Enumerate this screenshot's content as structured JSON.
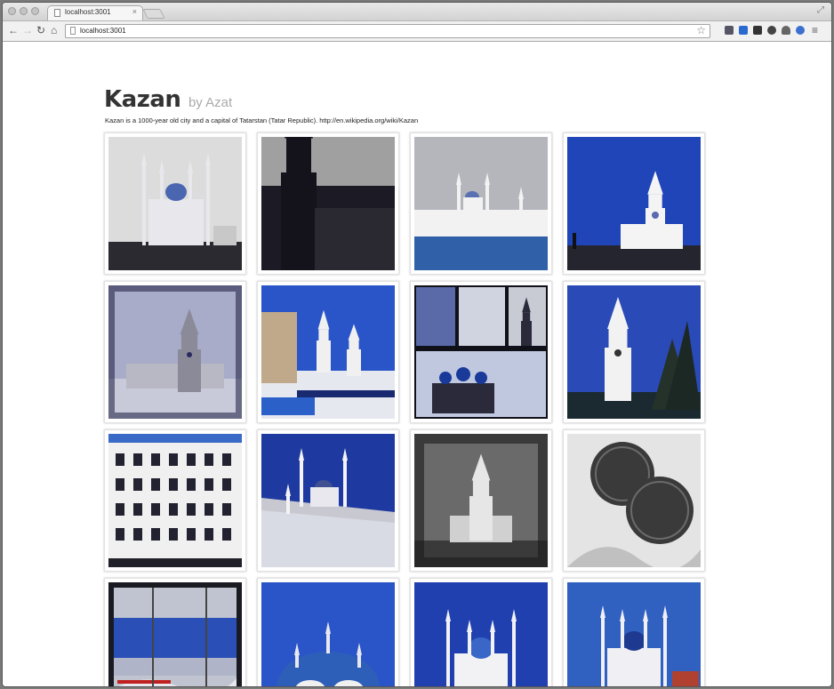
{
  "browser": {
    "tab_title": "localhost:3001",
    "tab_close": "×",
    "url": "localhost:3001"
  },
  "page": {
    "title": "Kazan",
    "subtitle": "by Azat",
    "description": "Kazan is a 1000-year old city and a capital of Tatarstan (Tatar Republic). http://en.wikipedia.org/wiki/Kazan"
  },
  "photos": [
    {
      "name": "photo-qolsharif-mosque",
      "scene": "mosque",
      "palette": {
        "sky": "#dcdcdc",
        "ground": "#2a2a30",
        "main": "#e8e8ec",
        "accent": "#4a66b0"
      }
    },
    {
      "name": "photo-dark-tower-silhouette",
      "scene": "silhouette",
      "palette": {
        "sky": "#b8b8b8",
        "ground": "#1c1a24",
        "main": "#14121a",
        "accent": "#2a2830"
      }
    },
    {
      "name": "photo-kremlin-winter-wall",
      "scene": "wall-mosque",
      "palette": {
        "sky": "#b4b6bc",
        "ground": "#3060a8",
        "main": "#f2f2f2",
        "accent": "#5a70b0"
      }
    },
    {
      "name": "photo-spasskaya-tower-blue-sky",
      "scene": "tower",
      "palette": {
        "sky": "#2045b8",
        "ground": "#252530",
        "main": "#f4f4f4",
        "accent": "#5a6ab0"
      }
    },
    {
      "name": "photo-tower-snow-vignette",
      "scene": "tower-snow",
      "palette": {
        "sky": "#a8acc8",
        "ground": "#c8cada",
        "main": "#8a8a98",
        "accent": "#2a2a60"
      }
    },
    {
      "name": "photo-kremlin-courtyard-snow",
      "scene": "courtyard",
      "palette": {
        "sky": "#2a55c8",
        "ground": "#e6e8f0",
        "main": "#f0f0f0",
        "accent": "#1a2a70"
      }
    },
    {
      "name": "photo-collage-churches",
      "scene": "collage",
      "palette": {
        "sky": "#d0d4e0",
        "ground": "#101018",
        "main": "#2a2a3a",
        "accent": "#1a3a9a"
      }
    },
    {
      "name": "photo-spasskaya-tower-trees",
      "scene": "tower-trees",
      "palette": {
        "sky": "#2a4ab8",
        "ground": "#1a2a30",
        "main": "#f2f2f2",
        "accent": "#24322a"
      }
    },
    {
      "name": "photo-university-facade",
      "scene": "facade",
      "palette": {
        "sky": "#3a6ac8",
        "ground": "#202028",
        "main": "#f0f0f0",
        "accent": "#222230"
      }
    },
    {
      "name": "photo-mosque-behind-wall",
      "scene": "mosque-wall",
      "palette": {
        "sky": "#1e3aa0",
        "ground": "#d8dae4",
        "main": "#f4f4f4",
        "accent": "#202030"
      }
    },
    {
      "name": "photo-tower-night-vignette",
      "scene": "tower-night",
      "palette": {
        "sky": "#6a6a6a",
        "ground": "#3a3a3a",
        "main": "#e6e6e6",
        "accent": "#1a1a1a"
      }
    },
    {
      "name": "photo-commemorative-coins",
      "scene": "coins",
      "palette": {
        "sky": "#e4e4e4",
        "ground": "#c0c0c0",
        "main": "#3a3a3a",
        "accent": "#6a6a6a"
      }
    },
    {
      "name": "photo-stadium-snow",
      "scene": "stadium",
      "palette": {
        "sky": "#c0c4d0",
        "ground": "#e8e8ee",
        "main": "#2a50b8",
        "accent": "#c02020"
      }
    },
    {
      "name": "photo-blue-domed-building",
      "scene": "dome",
      "palette": {
        "sky": "#2a55c8",
        "ground": "#303038",
        "main": "#2e5fb8",
        "accent": "#f0f0f0"
      }
    },
    {
      "name": "photo-qolsharif-night",
      "scene": "mosque-night",
      "palette": {
        "sky": "#2040b0",
        "ground": "#101020",
        "main": "#f2f2f4",
        "accent": "#3a66c8"
      }
    },
    {
      "name": "photo-qolsharif-blue-sky",
      "scene": "mosque-blue",
      "palette": {
        "sky": "#3060c0",
        "ground": "#2a2a34",
        "main": "#f0f0f4",
        "accent": "#1e3a90"
      }
    }
  ]
}
